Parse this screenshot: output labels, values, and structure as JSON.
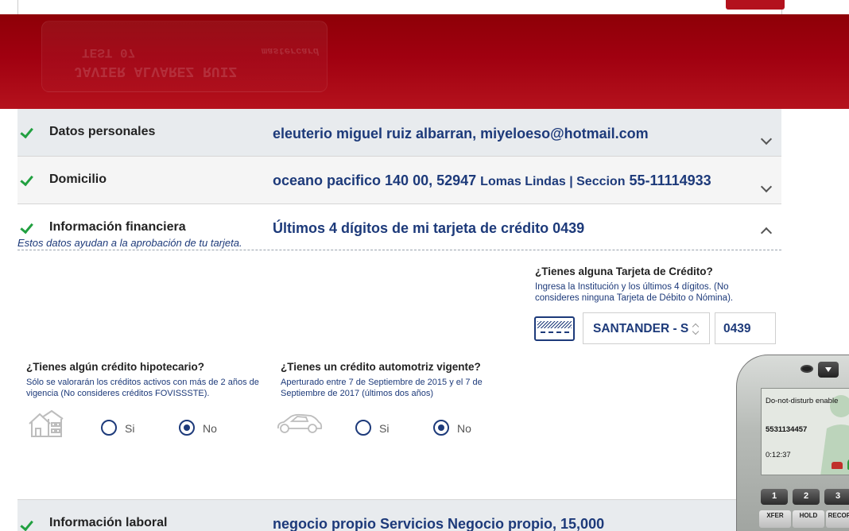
{
  "sections": {
    "personal": {
      "title": "Datos personales",
      "value": "eleuterio miguel ruiz albarran, miyeloeso@hotmail.com"
    },
    "address": {
      "title": "Domicilio",
      "value_main": "oceano pacifico 140 00, 52947",
      "value_small": "Lomas Lindas | Seccion",
      "value_tail": "55-11114933"
    },
    "financial": {
      "title": "Información financiera",
      "value": "Últimos 4 dígitos de mi tarjeta de crédito 0439",
      "subtitle": "Estos datos ayudan a la aprobación de tu tarjeta."
    },
    "work": {
      "title": "Información laboral",
      "value": "negocio propio Servicios Negocio propio, 15,000"
    }
  },
  "credit_card_question": {
    "title": "¿Tienes alguna Tarjeta de Crédito?",
    "help": "Ingresa la Institución y los últimos 4 dígitos. (No consideres ninguna Tarjeta de Débito o Nómina).",
    "institution_value": "SANTANDER - S",
    "last_digits_value": "0439"
  },
  "mortgage_question": {
    "title": "¿Tienes algún crédito hipotecario?",
    "help": "Sólo se valorarán los créditos activos con más de 2 años de vigencia (No consideres créditos FOVISSSTE).",
    "option_yes": "Si",
    "option_no": "No",
    "selected": "No"
  },
  "auto_question": {
    "title": "¿Tienes un crédito automotriz vigente?",
    "help": "Aperturado entre 7 de Septiembre de 2015 y el 7 de Septiembre de 2017 (últimos dos años)",
    "option_yes": "Si",
    "option_no": "No",
    "selected": "No"
  },
  "softphone": {
    "status": "Do-not-disturb enable",
    "number": "5531134457",
    "timer": "0:12:37",
    "keys": [
      "1",
      "2",
      "3"
    ],
    "buttons": [
      "XFER",
      "HOLD",
      "RECORD"
    ]
  },
  "colors": {
    "accent": "#1d3a7a",
    "banner": "#a00010",
    "check": "#21a040"
  }
}
